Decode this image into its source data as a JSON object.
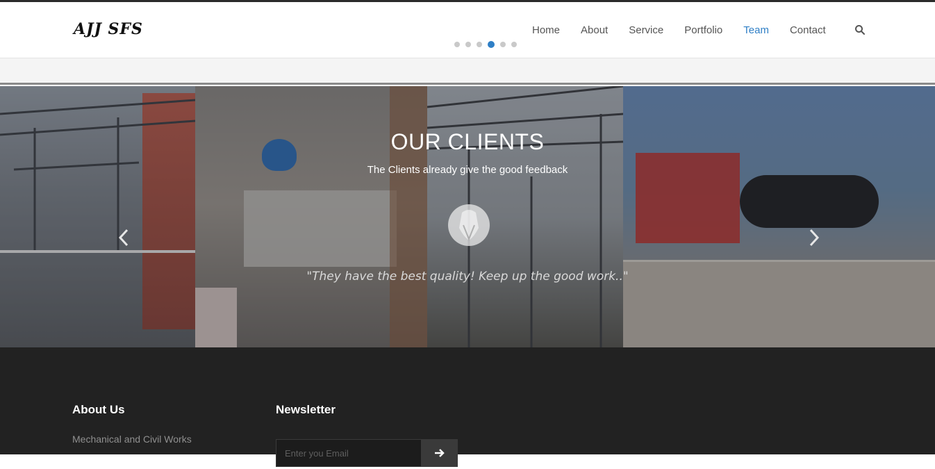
{
  "header": {
    "logo": "AJJ SFS",
    "nav": [
      {
        "label": "Home",
        "active": false
      },
      {
        "label": "About",
        "active": false
      },
      {
        "label": "Service",
        "active": false
      },
      {
        "label": "Portfolio",
        "active": false
      },
      {
        "label": "Team",
        "active": true
      },
      {
        "label": "Contact",
        "active": false
      }
    ],
    "search_icon": "search-icon",
    "slider_dots": {
      "count": 6,
      "active_index": 3
    }
  },
  "hero": {
    "title": "OUR CLIENTS",
    "subtitle": "The Clients already give the good feedback",
    "quote": "\"They have the best quality! Keep up the good work..\"",
    "prev_icon": "chevron-left-icon",
    "next_icon": "chevron-right-icon"
  },
  "footer": {
    "about_title": "About Us",
    "about_text": "Mechanical and Civil Works",
    "newsletter_title": "Newsletter",
    "email_placeholder": "Enter you Email",
    "send_icon": "arrow-right-icon"
  },
  "colors": {
    "accent": "#2f7fc6",
    "footer_bg": "#222222",
    "nav_text": "#555555"
  }
}
